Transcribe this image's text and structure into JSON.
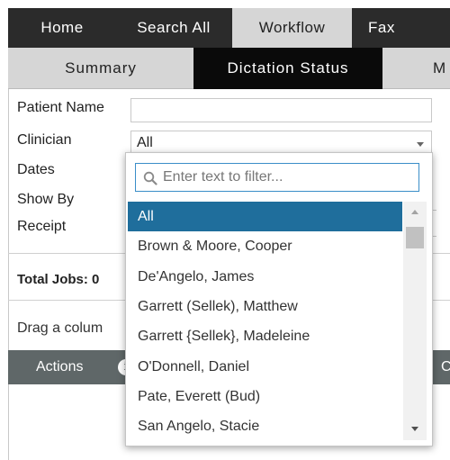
{
  "topnav": {
    "items": [
      {
        "label": "Home"
      },
      {
        "label": "Search All"
      },
      {
        "label": "Workflow"
      },
      {
        "label": "Fax"
      }
    ]
  },
  "subnav": {
    "items": [
      {
        "label": "Summary"
      },
      {
        "label": "Dictation Status"
      },
      {
        "label": "M"
      }
    ]
  },
  "form": {
    "patient_name_label": "Patient Name",
    "clinician_label": "Clinician",
    "clinician_value": "All",
    "dates_label": "Dates",
    "show_by_label": "Show By",
    "receipt_label": "Receipt"
  },
  "summary": {
    "total_jobs": "Total Jobs: 0",
    "drag_hint": "Drag a colum"
  },
  "grid": {
    "actions_label": "Actions",
    "info_icon_glyph": "i",
    "clipped_col": "Cl"
  },
  "dropdown": {
    "filter_placeholder": "Enter text to filter...",
    "selected": "All",
    "options": [
      "All",
      "Brown & Moore, Cooper",
      "De'Angelo, James",
      "Garrett (Sellek), Matthew",
      "Garrett {Sellek}, Madeleine",
      "O'Donnell, Daniel",
      "Pate, Everett (Bud)",
      "San Angelo, Stacie"
    ]
  },
  "colors": {
    "nav_bg": "#2b2b2b",
    "nav_active_bg": "#d6d6d6",
    "subnav_active_bg": "#0a0a0a",
    "selected_option_bg": "#1f6e9c",
    "grid_header_bg": "#5f6768",
    "filter_border": "#3a8ec8"
  },
  "icons": {
    "filter": "search-icon",
    "select_caret": "chevron-down-icon",
    "grid_info": "info-icon"
  }
}
